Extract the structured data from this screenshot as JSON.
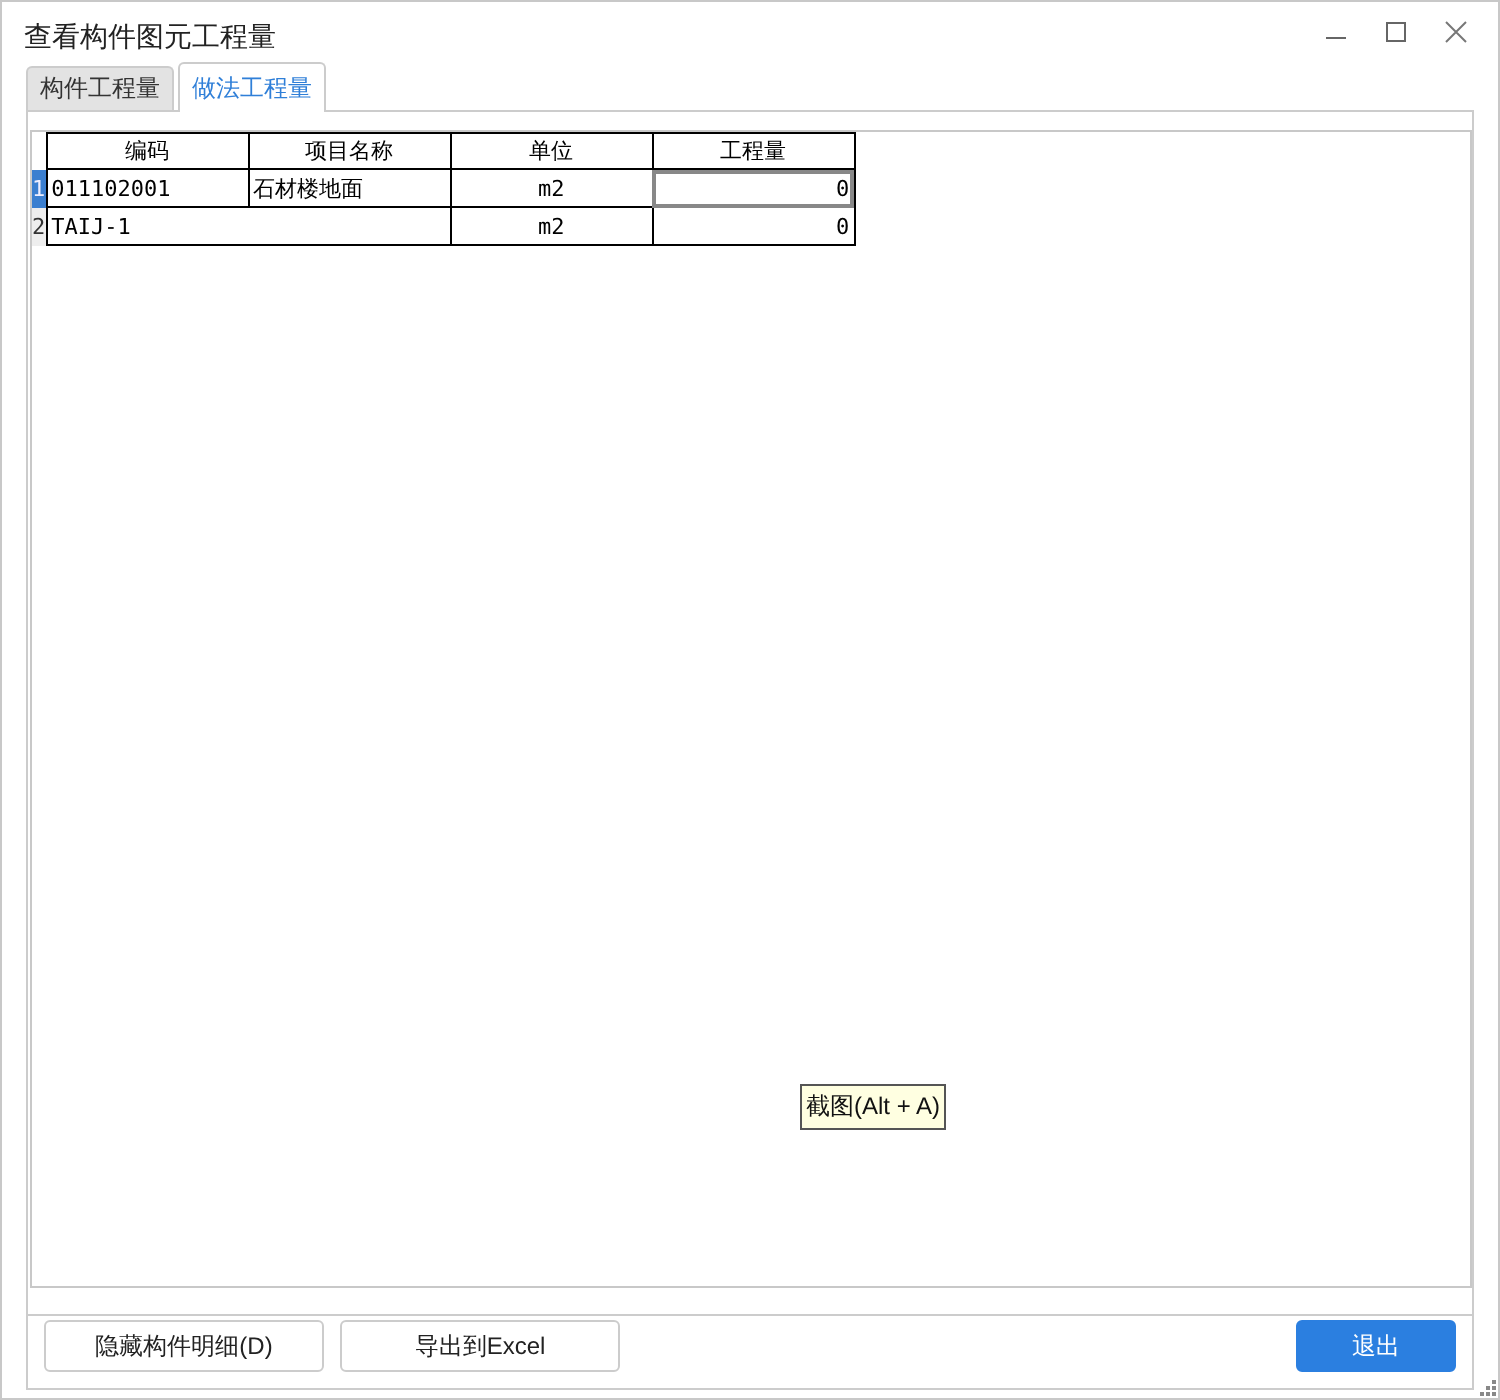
{
  "window": {
    "title": "查看构件图元工程量"
  },
  "tabs": [
    {
      "label": "构件工程量",
      "selected": false
    },
    {
      "label": "做法工程量",
      "selected": true
    }
  ],
  "table": {
    "columns": [
      "编码",
      "项目名称",
      "单位",
      "工程量"
    ],
    "rows": [
      {
        "number": "1",
        "selected": true,
        "code": "011102001",
        "name": "石材楼地面",
        "unit": "m2",
        "quantity": "0"
      },
      {
        "number": "2",
        "selected": false,
        "code": "TAIJ-1",
        "unit": "m2",
        "quantity": "0"
      }
    ]
  },
  "tooltip": "截图(Alt + A)",
  "buttons": [
    {
      "label": "隐藏构件明细(D)",
      "kind": "normal"
    },
    {
      "label": "导出到Excel",
      "kind": "normal"
    },
    {
      "label": "退出",
      "kind": "primary"
    }
  ]
}
